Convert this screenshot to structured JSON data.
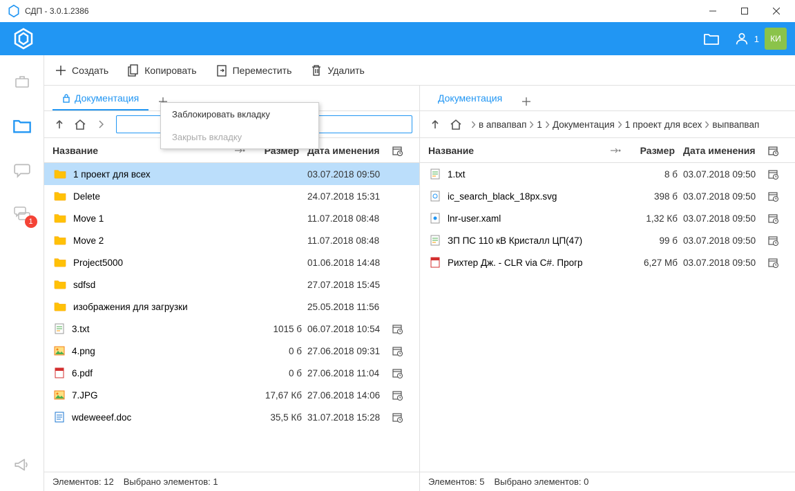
{
  "window": {
    "title": "СДП - 3.0.1.2386"
  },
  "topbar": {
    "user_count": "1",
    "avatar": "КИ"
  },
  "sidebar": {
    "badge": "1"
  },
  "toolbar": {
    "create": "Создать",
    "copy": "Копировать",
    "move": "Переместить",
    "delete": "Удалить"
  },
  "contextmenu": {
    "lock": "Заблокировать вкладку",
    "close": "Закрыть вкладку"
  },
  "headers": {
    "name": "Название",
    "size": "Размер",
    "date": "Дата именения"
  },
  "left": {
    "tab": "Документация",
    "rows": [
      {
        "icon": "folder",
        "name": "1 проект для всех",
        "size": "",
        "date": "03.07.2018 09:50",
        "cal": false,
        "selected": true
      },
      {
        "icon": "folder",
        "name": "Delete",
        "size": "",
        "date": "24.07.2018 15:31",
        "cal": false
      },
      {
        "icon": "folder",
        "name": "Move 1",
        "size": "",
        "date": "11.07.2018 08:48",
        "cal": false
      },
      {
        "icon": "folder",
        "name": "Move 2",
        "size": "",
        "date": "11.07.2018 08:48",
        "cal": false
      },
      {
        "icon": "folder",
        "name": "Project5000",
        "size": "",
        "date": "01.06.2018 14:48",
        "cal": false
      },
      {
        "icon": "folder",
        "name": "sdfsd",
        "size": "",
        "date": "27.07.2018 15:45",
        "cal": false
      },
      {
        "icon": "folder",
        "name": "изображения для загрузки",
        "size": "",
        "date": "25.05.2018 11:56",
        "cal": false
      },
      {
        "icon": "txt",
        "name": "3.txt",
        "size": "1015 б",
        "date": "06.07.2018 10:54",
        "cal": true
      },
      {
        "icon": "img",
        "name": "4.png",
        "size": "0 б",
        "date": "27.06.2018 09:31",
        "cal": true
      },
      {
        "icon": "pdf",
        "name": "6.pdf",
        "size": "0 б",
        "date": "27.06.2018 11:04",
        "cal": true
      },
      {
        "icon": "img",
        "name": "7.JPG",
        "size": "17,67 Кб",
        "date": "27.06.2018 14:06",
        "cal": true
      },
      {
        "icon": "doc",
        "name": "wdeweeef.doc",
        "size": "35,5 Кб",
        "date": "31.07.2018 15:28",
        "cal": true
      }
    ],
    "status": {
      "count": "Элементов: 12",
      "selected": "Выбрано элементов: 1"
    }
  },
  "right": {
    "tab": "Документация",
    "breadcrumb": [
      "в апвапвап",
      "1",
      "Документация",
      "1 проект для всех",
      "выпвапвап"
    ],
    "rows": [
      {
        "icon": "txt",
        "name": "1.txt",
        "size": "8 б",
        "date": "03.07.2018 09:50",
        "cal": true
      },
      {
        "icon": "svg",
        "name": "ic_search_black_18px.svg",
        "size": "398 б",
        "date": "03.07.2018 09:50",
        "cal": true
      },
      {
        "icon": "xaml",
        "name": "lnr-user.xaml",
        "size": "1,32 Кб",
        "date": "03.07.2018 09:50",
        "cal": true
      },
      {
        "icon": "txt",
        "name": "ЗП ПС 110 кВ Кристалл ЦП(47)",
        "size": "99 б",
        "date": "03.07.2018 09:50",
        "cal": true
      },
      {
        "icon": "pdf",
        "name": "Рихтер Дж. - CLR via C#. Прогр",
        "size": "6,27 Мб",
        "date": "03.07.2018 09:50",
        "cal": true
      }
    ],
    "status": {
      "count": "Элементов: 5",
      "selected": "Выбрано элементов: 0"
    }
  }
}
